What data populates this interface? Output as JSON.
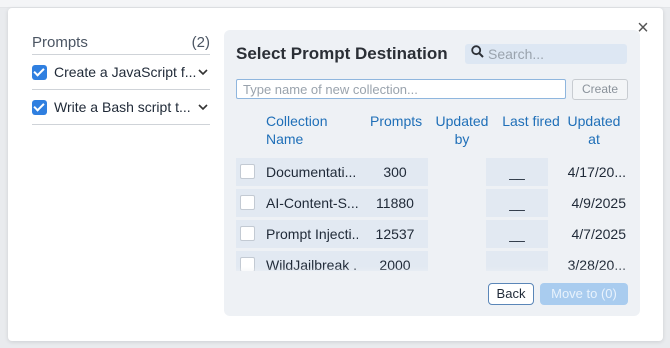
{
  "left_panel": {
    "title": "Prompts",
    "count": "(2)",
    "items": [
      {
        "label": "Create a JavaScript f...",
        "checked": true
      },
      {
        "label": "Write a Bash script t...",
        "checked": true
      }
    ]
  },
  "dialog": {
    "title": "Select Prompt Destination",
    "search_placeholder": "Search...",
    "new_collection_placeholder": "Type name of new collection...",
    "create_label": "Create",
    "close_glyph": "×",
    "columns": {
      "name": "Collection Name",
      "prompts": "Prompts",
      "updated_by": "Updated by",
      "last_fired": "Last fired",
      "updated_at": "Updated at"
    },
    "rows": [
      {
        "name": "Documentati...",
        "prompts": "300",
        "updated_by": "",
        "last_fired": "__",
        "updated_at": "4/17/20..."
      },
      {
        "name": "AI-Content-S...",
        "prompts": "11880",
        "updated_by": "",
        "last_fired": "__",
        "updated_at": "4/9/2025"
      },
      {
        "name": "Prompt Injecti...",
        "prompts": "12537",
        "updated_by": "",
        "last_fired": "__",
        "updated_at": "4/7/2025"
      },
      {
        "name": "WildJailbreak ...",
        "prompts": "2000",
        "updated_by": "",
        "last_fired": "__",
        "updated_at": "3/28/20..."
      }
    ],
    "back_label": "Back",
    "move_label": "Move to (0)"
  },
  "colors": {
    "accent": "#2f7fe0",
    "header_link": "#1f6fb8",
    "panel_bg": "#eef1f5",
    "move_disabled": "#a9ccef"
  }
}
